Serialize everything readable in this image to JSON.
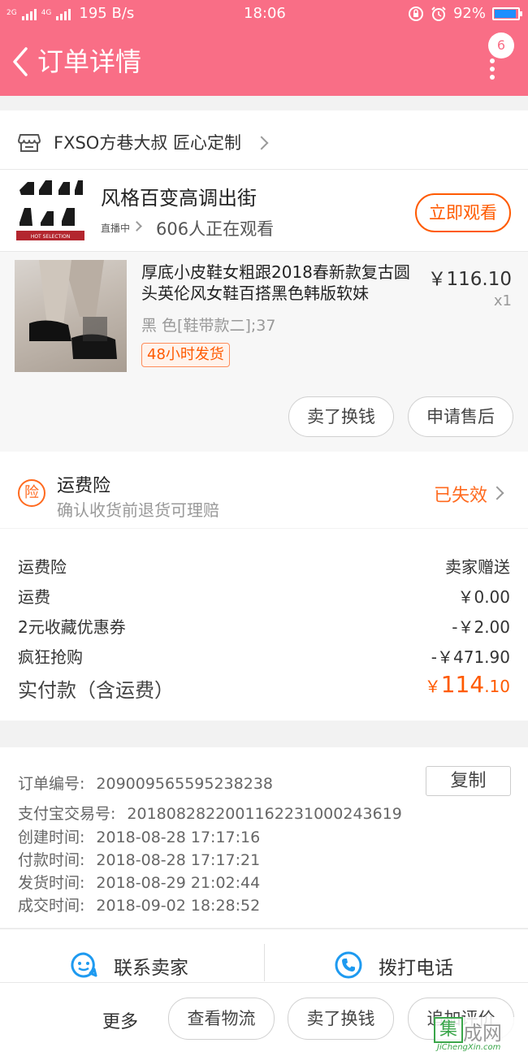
{
  "status_bar": {
    "network_left": "2G",
    "network_right": "4G",
    "speed": "195 B/s",
    "time": "18:06",
    "battery": "92%",
    "battery_level": 0.92
  },
  "header": {
    "title": "订单详情",
    "badge_count": "6"
  },
  "shop": {
    "name": "FXSO方巷大叔 匠心定制"
  },
  "live": {
    "title": "风格百变高调出街",
    "tag": "直播中",
    "watching": "606人正在观看",
    "watch_button": "立即观看"
  },
  "product": {
    "title": "厚底小皮鞋女粗跟2018春新款复古圆头英伦风女鞋百搭黑色韩版软妹",
    "price": "￥116.10",
    "quantity": "x1",
    "sku": "黑 色[鞋带款二];37",
    "shipping_tag": "48小时发货",
    "btn_sell": "卖了换钱",
    "btn_after_sale": "申请售后"
  },
  "insurance": {
    "icon_text": "险",
    "title": "运费险",
    "subtitle": "确认收货前退货可理赔",
    "status": "已失效"
  },
  "fees": [
    {
      "label": "运费险",
      "value": "卖家赠送"
    },
    {
      "label": "运费",
      "value": "￥0.00"
    },
    {
      "label": "2元收藏优惠券",
      "value": "-￥2.00"
    },
    {
      "label": "疯狂抢购",
      "value": "-￥471.90"
    }
  ],
  "total": {
    "label": "实付款（含运费）",
    "currency": "￥",
    "integer": "114",
    "decimal": ".10"
  },
  "order_info": {
    "order_no_label": "订单编号:",
    "order_no": "209009565595238238",
    "copy_button": "复制",
    "alipay_label": "支付宝交易号:",
    "alipay_no": "2018082822001162231000243619",
    "created_label": "创建时间:",
    "created": "2018-08-28 17:17:16",
    "paid_label": "付款时间:",
    "paid": "2018-08-28 17:17:21",
    "shipped_label": "发货时间:",
    "shipped": "2018-08-29 21:02:44",
    "completed_label": "成交时间:",
    "completed": "2018-09-02 18:28:52"
  },
  "contact": {
    "seller": "联系卖家",
    "phone": "拨打电话"
  },
  "bottom_bar": {
    "more": "更多",
    "logistics": "查看物流",
    "sell": "卖了换钱",
    "review": "追加评价"
  },
  "watermark": {
    "box": "集",
    "text": "成网",
    "url": "JiChengXin.com"
  },
  "colors": {
    "header": "#f96e86",
    "accent": "#ff5a00",
    "insurance": "#ff6a1f",
    "contact_icon": "#1e9af0"
  }
}
